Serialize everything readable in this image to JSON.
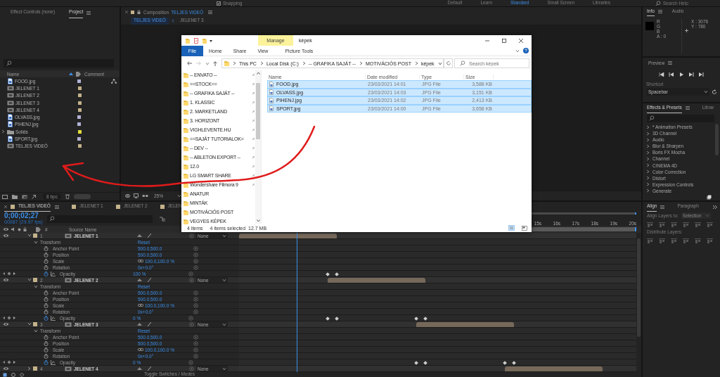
{
  "top_bar": {
    "snapping": {
      "label": "Snapping",
      "checked": true
    },
    "workspaces": [
      {
        "label": "Default",
        "selected": false
      },
      {
        "label": "Learn",
        "selected": false
      },
      {
        "label": "Standard",
        "selected": true
      },
      {
        "label": "Small Screen",
        "selected": false
      },
      {
        "label": "Libraries",
        "selected": false
      }
    ],
    "search": {
      "placeholder": "Search Help"
    }
  },
  "project_panel": {
    "tabs": [
      {
        "label": "Effect Controls (none)",
        "selected": false
      },
      {
        "label": "Project",
        "selected": true
      }
    ],
    "columns": [
      "Name",
      "Comment"
    ],
    "items": [
      {
        "name": "FOOD.jpg",
        "kind": "image",
        "color": "#b1b1d6"
      },
      {
        "name": "JELENET 1",
        "kind": "comp",
        "color": "#c4b28a"
      },
      {
        "name": "JELENET 2",
        "kind": "comp",
        "color": "#c4b28a"
      },
      {
        "name": "JELENET 3",
        "kind": "comp",
        "color": "#c4b28a"
      },
      {
        "name": "JELENET 4",
        "kind": "comp",
        "color": "#c4b28a"
      },
      {
        "name": "OLVASS.jpg",
        "kind": "image",
        "color": "#b1b1d6"
      },
      {
        "name": "PIHENJ.jpg",
        "kind": "image",
        "color": "#b1b1d6"
      },
      {
        "name": "Solids",
        "kind": "folder",
        "color": "#e2de3c",
        "expanded": false
      },
      {
        "name": "SPORT.jpg",
        "kind": "image",
        "color": "#b1b1d6"
      },
      {
        "name": "TELJES VIDEÓ",
        "kind": "comp",
        "color": "#c4b28a"
      }
    ],
    "bit_depth": "8 bpc"
  },
  "composition": {
    "title": "Composition",
    "name": "TELJES VIDEÓ",
    "tabs": [
      {
        "label": "TELJES VIDEÓ",
        "selected": true
      },
      {
        "label": "JELENET 3",
        "selected": false
      }
    ],
    "zoom": "25%"
  },
  "info": {
    "tabs": [
      {
        "label": "Info",
        "selected": true
      },
      {
        "label": "Audio",
        "selected": false
      }
    ],
    "channels": [
      "R",
      "G",
      "B",
      "A : 0"
    ],
    "coordinates": [
      "X : 3076",
      "Y : 780"
    ]
  },
  "preview": {
    "title": "Preview",
    "shortcut_label": "Shortcut",
    "shortcut": "Spacebar"
  },
  "effects": {
    "tabs": [
      {
        "label": "Effects & Presets",
        "selected": true
      },
      {
        "label": "Librar",
        "selected": false
      }
    ],
    "items": [
      {
        "label": "* Animation Presets",
        "expanded": false
      },
      {
        "label": "3D Channel",
        "expanded": false
      },
      {
        "label": "Audio",
        "expanded": false
      },
      {
        "label": "Blur & Sharpen",
        "expanded": false
      },
      {
        "label": "Boris FX Mocha",
        "expanded": false
      },
      {
        "label": "Channel",
        "expanded": false
      },
      {
        "label": "CINEMA 4D",
        "expanded": false
      },
      {
        "label": "Color Correction",
        "expanded": false
      },
      {
        "label": "Distort",
        "expanded": false
      },
      {
        "label": "Expression Controls",
        "expanded": false
      },
      {
        "label": "Generate",
        "expanded": false
      }
    ]
  },
  "timeline": {
    "tabs": [
      {
        "label": "TELJES VIDEÓ",
        "selected": true
      },
      {
        "label": "JELENET 1",
        "selected": false
      },
      {
        "label": "JELENET 2",
        "selected": false
      },
      {
        "label": "JELEN",
        "selected": false
      }
    ],
    "timecode": "0;00;02;27",
    "frame": "00087 (29.97 fps)",
    "columns": [
      "#",
      "Source Name"
    ],
    "ruler": [
      "15s",
      "16s",
      "17s",
      "18s",
      "19s",
      "20s"
    ],
    "layers": [
      {
        "number": "1",
        "name": "JELENET 1",
        "color": "#c4b28a",
        "parent": "None",
        "expanded": true,
        "properties": [
          {
            "kind": "group",
            "name": "Transform",
            "value": "Reset"
          },
          {
            "kind": "static",
            "name": "Anchor Point",
            "value": "500.0,500.0"
          },
          {
            "kind": "static",
            "name": "Position",
            "value": "500.0,500.0"
          },
          {
            "kind": "scale",
            "name": "Scale",
            "value": "100.0,100.0 %"
          },
          {
            "kind": "static",
            "name": "Rotation",
            "value": "0x+0.0°"
          },
          {
            "kind": "animated",
            "name": "Opacity",
            "value": "100 %"
          }
        ]
      },
      {
        "number": "2",
        "name": "JELENET 2",
        "color": "#c4b28a",
        "parent": "None",
        "expanded": true,
        "properties": [
          {
            "kind": "group",
            "name": "Transform",
            "value": "Reset"
          },
          {
            "kind": "static",
            "name": "Anchor Point",
            "value": "500.0,500.0"
          },
          {
            "kind": "static",
            "name": "Position",
            "value": "500.0,500.0"
          },
          {
            "kind": "scale",
            "name": "Scale",
            "value": "100.0,100.0 %"
          },
          {
            "kind": "static",
            "name": "Rotation",
            "value": "0x+0.0°"
          },
          {
            "kind": "animated",
            "name": "Opacity",
            "value": "0 %"
          }
        ]
      },
      {
        "number": "3",
        "name": "JELENET 3",
        "color": "#c4b28a",
        "parent": "None",
        "expanded": true,
        "properties": [
          {
            "kind": "group",
            "name": "Transform",
            "value": "Reset"
          },
          {
            "kind": "static",
            "name": "Anchor Point",
            "value": "500.0,500.0"
          },
          {
            "kind": "static",
            "name": "Position",
            "value": "500.0,500.0"
          },
          {
            "kind": "scale",
            "name": "Scale",
            "value": "100.0,100.0 %"
          },
          {
            "kind": "static",
            "name": "Rotation",
            "value": "0x+0.0°"
          },
          {
            "kind": "animated",
            "name": "Opacity",
            "value": "0 %"
          }
        ]
      },
      {
        "number": "4",
        "name": "JELENET 4",
        "color": "#c4b28a",
        "parent": "None",
        "expanded": false
      }
    ],
    "footer": "Toggle Switches / Modes"
  },
  "align": {
    "tabs": [
      {
        "label": "Align",
        "selected": true
      },
      {
        "label": "Paragraph",
        "selected": false
      }
    ],
    "align_to_label": "Align Layers to:",
    "align_to": "Selection",
    "distribute_label": "Distribute Layers:"
  },
  "explorer": {
    "title": "képek",
    "context_tab": "Manage",
    "ribbon_tabs": [
      {
        "label": "File",
        "kind": "file"
      },
      {
        "label": "Home",
        "kind": "tab"
      },
      {
        "label": "Share",
        "kind": "tab"
      },
      {
        "label": "View",
        "kind": "tab"
      },
      {
        "label": "Picture Tools",
        "kind": "context"
      }
    ],
    "breadcrumb": [
      "This PC",
      "Local Disk (C:)",
      "-- GRAFIKA SAJÁT --",
      "MOTIVÁCIÓS POST",
      "képek"
    ],
    "search": {
      "placeholder": "Search képek"
    },
    "nav": [
      {
        "name": "-- ENVATO --",
        "pinned": true
      },
      {
        "name": "==STOCK==",
        "pinned": true
      },
      {
        "name": "-- GRAFIKA SAJÁT --",
        "pinned": true
      },
      {
        "name": "1. KLASSIC",
        "pinned": true
      },
      {
        "name": "2. MARKETLAND",
        "pinned": true
      },
      {
        "name": "3. HORIZONT",
        "pinned": true
      },
      {
        "name": "VIGHLEVENTE.HU",
        "pinned": true
      },
      {
        "name": "==SAJÁT TUTORIALOK=",
        "pinned": true
      },
      {
        "name": "-- DEV --",
        "pinned": true
      },
      {
        "name": "-- ABLETON EXPORT --",
        "pinned": true
      },
      {
        "name": "12.0",
        "pinned": true
      },
      {
        "name": "LG SMART SHARE",
        "pinned": true
      },
      {
        "name": "Wondershare Filmora 9",
        "pinned": true
      },
      {
        "name": "ANATUR",
        "pinned": false
      },
      {
        "name": "MINTÁK",
        "pinned": false
      },
      {
        "name": "MOTIVÁCIÓS POST",
        "pinned": false
      },
      {
        "name": "VEGYES KÉPEK",
        "pinned": false
      }
    ],
    "columns": [
      "Name",
      "Date modified",
      "Type",
      "Size"
    ],
    "files": [
      {
        "name": "FOOD.jpg",
        "date": "23/03/2021 14:01",
        "type": "JPG File",
        "size": "3,588 KB",
        "selected": true
      },
      {
        "name": "OLVASS.jpg",
        "date": "23/03/2021 14:03",
        "type": "JPG File",
        "size": "3,151 KB",
        "selected": true
      },
      {
        "name": "PIHENJ.jpg",
        "date": "23/03/2021 14:02",
        "type": "JPG File",
        "size": "2,413 KB",
        "selected": true
      },
      {
        "name": "SPORT.jpg",
        "date": "23/03/2021 14:00",
        "type": "JPG File",
        "size": "3,658 KB",
        "selected": true
      }
    ],
    "status": {
      "count": "4 items",
      "selection": "4 items selected  12.7 MB"
    }
  }
}
